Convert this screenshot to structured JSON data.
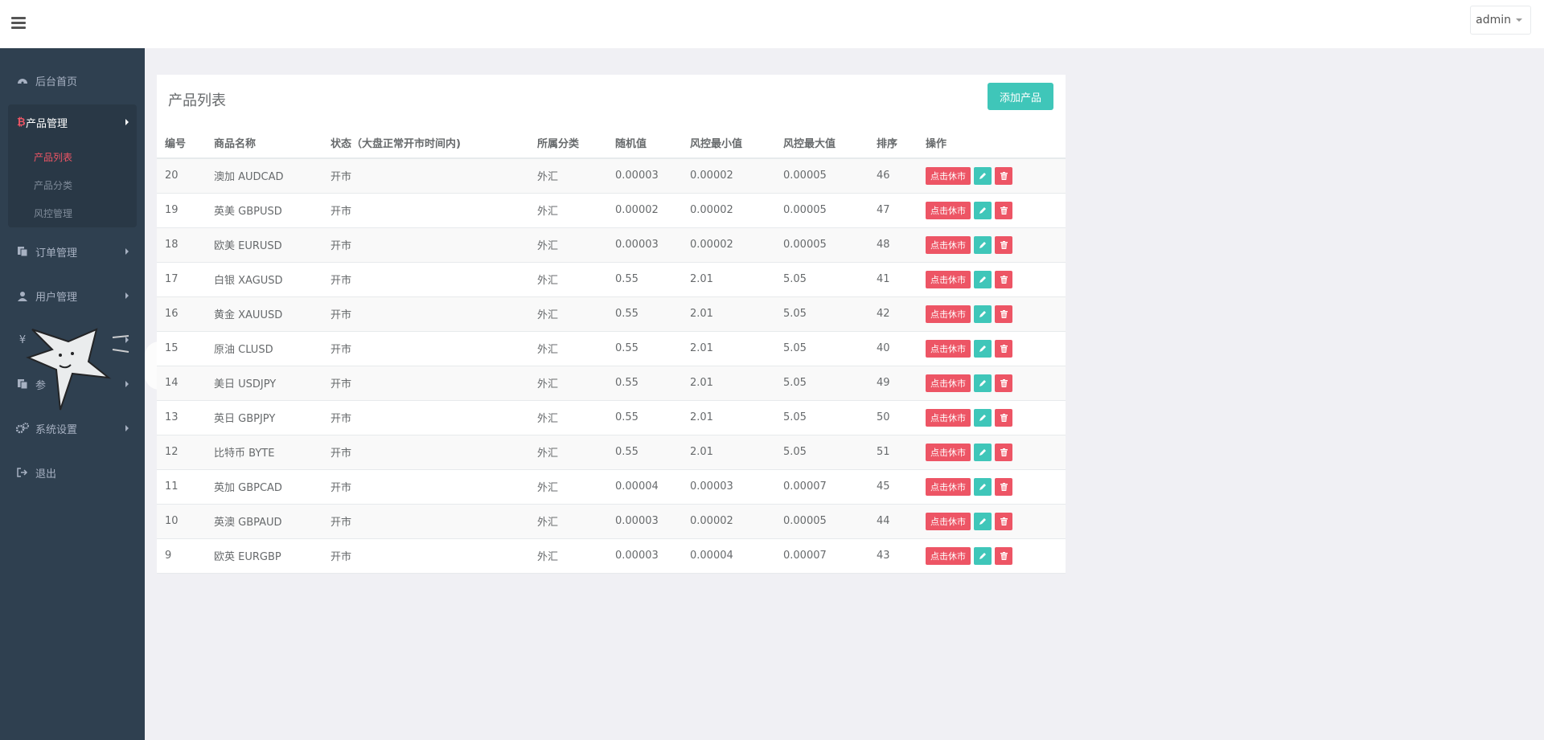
{
  "header": {
    "user": "admin"
  },
  "sidebar": {
    "items": [
      {
        "label": "后台首页",
        "icon": "dashboard-icon"
      },
      {
        "label": "产品管理",
        "icon": "bitcoin-icon"
      },
      {
        "label": "订单管理",
        "icon": "copy-icon"
      },
      {
        "label": "用户管理",
        "icon": "user-icon"
      },
      {
        "label": "",
        "icon": "yen-icon"
      },
      {
        "label": "参",
        "icon": "copy-icon"
      },
      {
        "label": "系统设置",
        "icon": "gears-icon"
      },
      {
        "label": "退出",
        "icon": "sign-out-icon"
      }
    ],
    "subitems": [
      "产品列表",
      "产品分类",
      "风控管理"
    ]
  },
  "panel": {
    "title": "产品列表",
    "add_label": "添加产品"
  },
  "table": {
    "headers": [
      "编号",
      "商品名称",
      "状态（大盘正常开市时间内)",
      "所属分类",
      "随机值",
      "风控最小值",
      "风控最大值",
      "排序",
      "操作"
    ],
    "rows": [
      [
        "20",
        "澳加 AUDCAD",
        "开市",
        "外汇",
        "0.00003",
        "0.00002",
        "0.00005",
        "46"
      ],
      [
        "19",
        "英美 GBPUSD",
        "开市",
        "外汇",
        "0.00002",
        "0.00002",
        "0.00005",
        "47"
      ],
      [
        "18",
        "欧美 EURUSD",
        "开市",
        "外汇",
        "0.00003",
        "0.00002",
        "0.00005",
        "48"
      ],
      [
        "17",
        "白银 XAGUSD",
        "开市",
        "外汇",
        "0.55",
        "2.01",
        "5.05",
        "41"
      ],
      [
        "16",
        "黄金 XAUUSD",
        "开市",
        "外汇",
        "0.55",
        "2.01",
        "5.05",
        "42"
      ],
      [
        "15",
        "原油 CLUSD",
        "开市",
        "外汇",
        "0.55",
        "2.01",
        "5.05",
        "40"
      ],
      [
        "14",
        "美日 USDJPY",
        "开市",
        "外汇",
        "0.55",
        "2.01",
        "5.05",
        "49"
      ],
      [
        "13",
        "英日 GBPJPY",
        "开市",
        "外汇",
        "0.55",
        "2.01",
        "5.05",
        "50"
      ],
      [
        "12",
        "比特币 BYTE",
        "开市",
        "外汇",
        "0.55",
        "2.01",
        "5.05",
        "51"
      ],
      [
        "11",
        "英加 GBPCAD",
        "开市",
        "外汇",
        "0.00004",
        "0.00003",
        "0.00007",
        "45"
      ],
      [
        "10",
        "英澳 GBPAUD",
        "开市",
        "外汇",
        "0.00003",
        "0.00002",
        "0.00005",
        "44"
      ],
      [
        "9",
        "欧英 EURGBP",
        "开市",
        "外汇",
        "0.00003",
        "0.00004",
        "0.00007",
        "43"
      ]
    ],
    "rest_label": "点击休市",
    "edit_icon": "pencil-icon",
    "delete_icon": "trash-icon"
  },
  "colors": {
    "sidebar": "#2f4050",
    "accent": "#3fc6b9",
    "danger": "#ed5565"
  }
}
